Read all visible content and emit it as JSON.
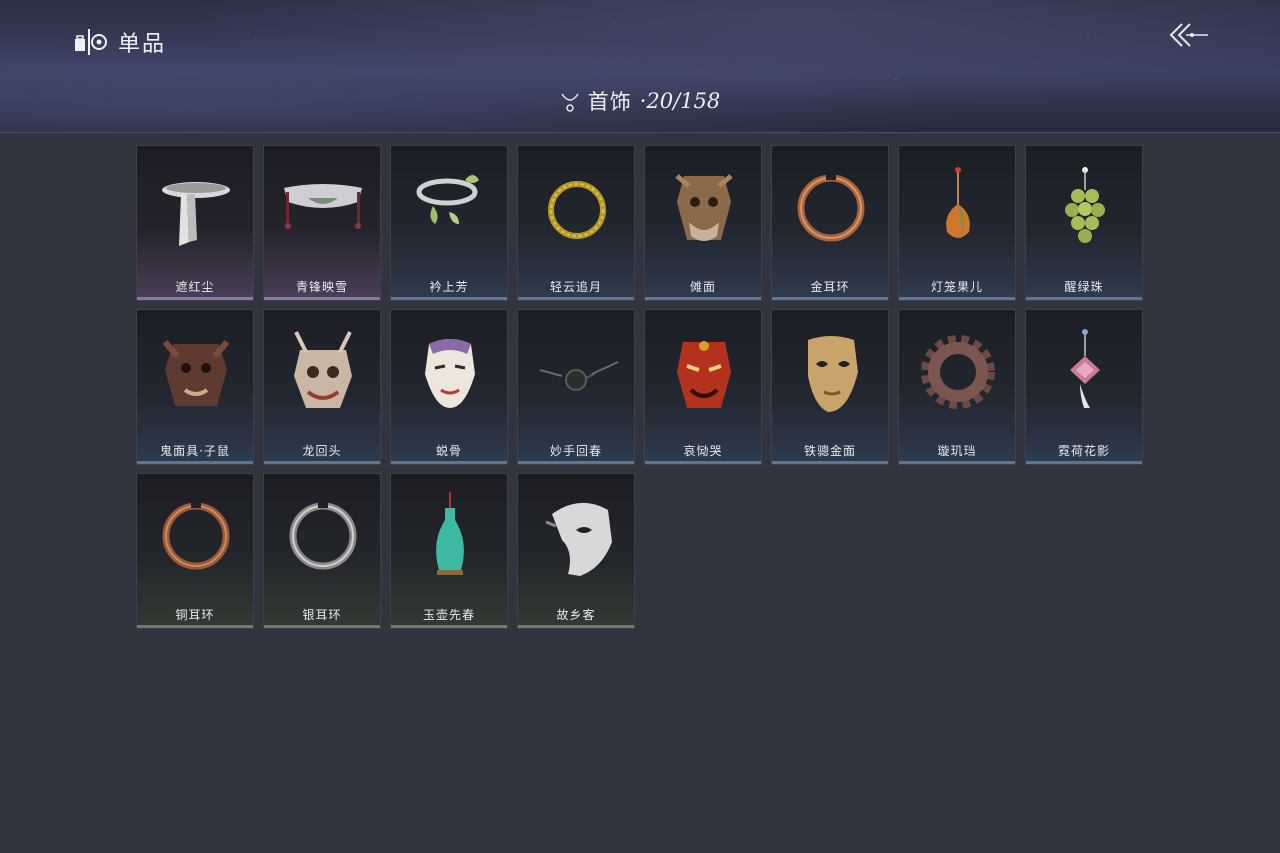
{
  "header": {
    "title": "单品",
    "category_name": "首饰",
    "category_count": "·20/158"
  },
  "icons": {
    "brand": "collection-icon",
    "back": "back-arrow-icon",
    "category": "necklace-icon"
  },
  "items": [
    {
      "label": "遮红尘",
      "rarity": "purple",
      "icon": "white-ribbon-icon"
    },
    {
      "label": "青锋映雪",
      "rarity": "purple",
      "icon": "ribbon-tiara-icon"
    },
    {
      "label": "衿上芳",
      "rarity": "blue",
      "icon": "ginkgo-bracelet-icon"
    },
    {
      "label": "轻云追月",
      "rarity": "blue",
      "icon": "gold-torque-icon"
    },
    {
      "label": "傩面",
      "rarity": "blue",
      "icon": "nuo-mask-icon"
    },
    {
      "label": "金耳环",
      "rarity": "blue",
      "icon": "gold-earring-icon"
    },
    {
      "label": "灯笼果儿",
      "rarity": "blue",
      "icon": "lantern-fruit-icon"
    },
    {
      "label": "醒绿珠",
      "rarity": "blue",
      "icon": "green-grape-pin-icon"
    },
    {
      "label": "鬼面具·子鼠",
      "rarity": "blue",
      "icon": "rat-demon-mask-icon"
    },
    {
      "label": "龙回头",
      "rarity": "blue",
      "icon": "dragon-mask-icon"
    },
    {
      "label": "蜕骨",
      "rarity": "blue",
      "icon": "opera-mask-icon"
    },
    {
      "label": "妙手回春",
      "rarity": "blue",
      "icon": "round-glasses-icon"
    },
    {
      "label": "哀恸哭",
      "rarity": "blue",
      "icon": "red-oni-mask-icon"
    },
    {
      "label": "铁骢金面",
      "rarity": "blue",
      "icon": "gold-face-mask-icon"
    },
    {
      "label": "璇玑珰",
      "rarity": "blue",
      "icon": "gear-ring-icon"
    },
    {
      "label": "霓荷花影",
      "rarity": "blue",
      "icon": "lotus-hairpin-icon"
    },
    {
      "label": "铜耳环",
      "rarity": "green",
      "icon": "copper-earring-icon"
    },
    {
      "label": "银耳环",
      "rarity": "green",
      "icon": "silver-earring-icon"
    },
    {
      "label": "玉壶先春",
      "rarity": "green",
      "icon": "jade-vase-icon"
    },
    {
      "label": "故乡客",
      "rarity": "green",
      "icon": "white-half-mask-icon"
    }
  ],
  "colors": {
    "background": "#323540",
    "rarity_purple": "#8a78a8",
    "rarity_blue": "#5c7698",
    "rarity_green": "#6c7d68"
  }
}
